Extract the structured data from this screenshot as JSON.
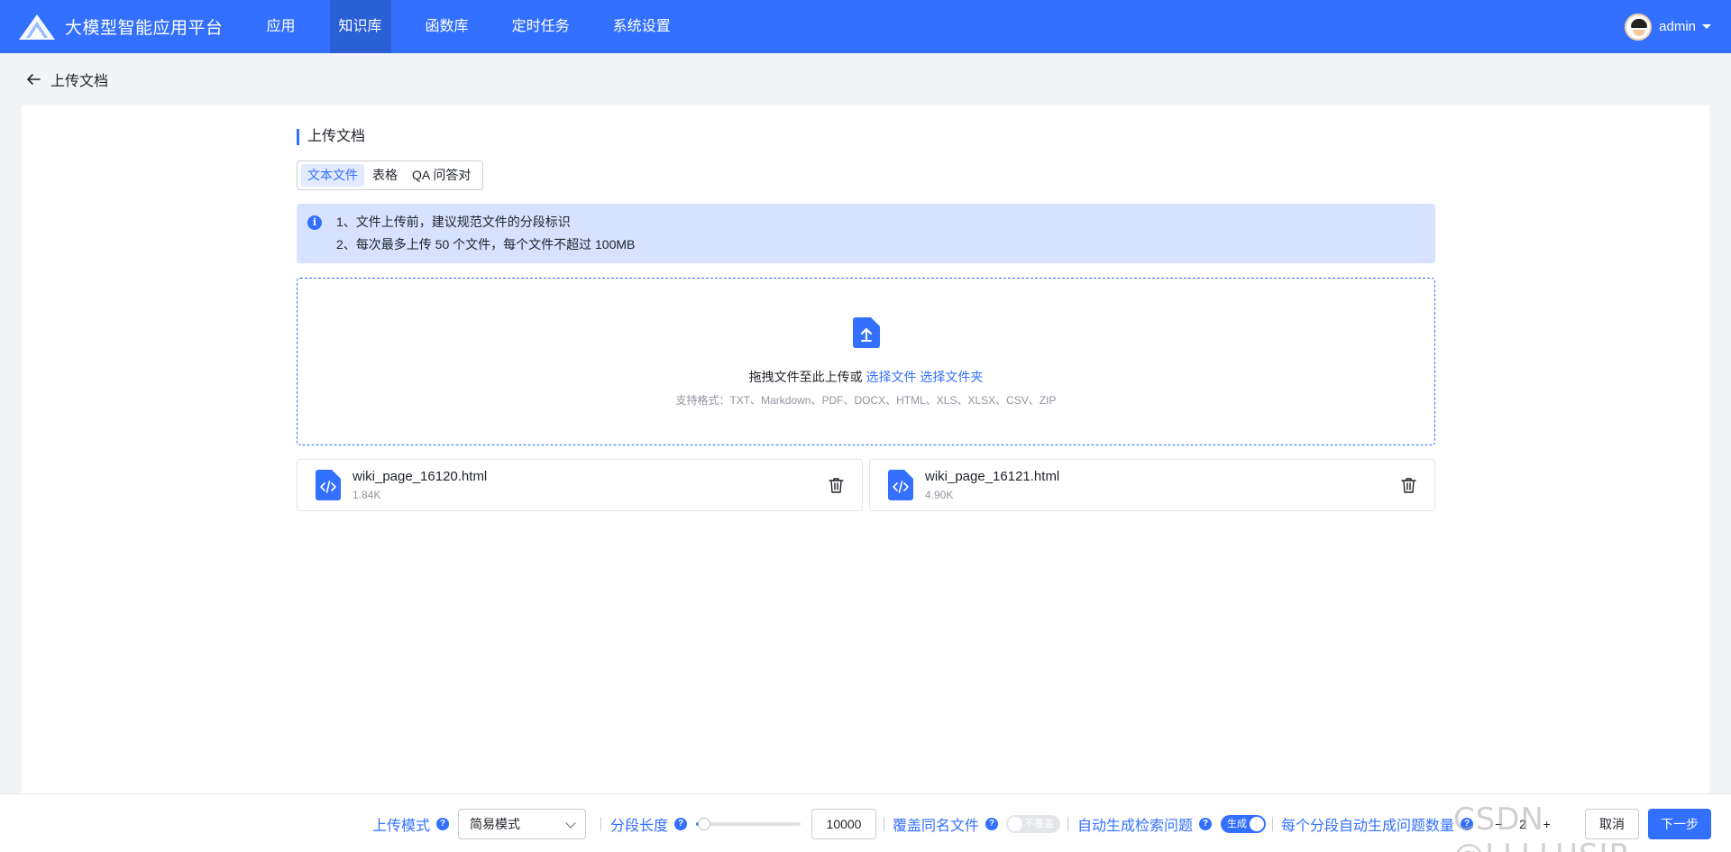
{
  "header": {
    "brand": "大模型智能应用平台",
    "nav": [
      {
        "label": "应用",
        "active": false
      },
      {
        "label": "知识库",
        "active": true
      },
      {
        "label": "函数库",
        "active": false
      },
      {
        "label": "定时任务",
        "active": false
      },
      {
        "label": "系统设置",
        "active": false
      }
    ],
    "user": "admin",
    "accent": "#3370ff"
  },
  "breadcrumb": {
    "back_label": "上传文档"
  },
  "main": {
    "section_title": "上传文档",
    "tabs": [
      {
        "label": "文本文件",
        "active": true
      },
      {
        "label": "表格",
        "active": false
      },
      {
        "label": "QA 问答对",
        "active": false
      }
    ],
    "notice": {
      "line1": "1、文件上传前，建议规范文件的分段标识",
      "line2": "2、每次最多上传 50 个文件，每个文件不超过 100MB"
    },
    "dropzone": {
      "text": "拖拽文件至此上传或",
      "select_file": "选择文件",
      "select_folder": "选择文件夹",
      "hint": "支持格式：TXT、Markdown、PDF、DOCX、HTML、XLS、XLSX、CSV、ZIP"
    },
    "files": [
      {
        "name": "wiki_page_16120.html",
        "size": "1.84K",
        "icon": "html-file-icon"
      },
      {
        "name": "wiki_page_16121.html",
        "size": "4.90K",
        "icon": "html-file-icon"
      }
    ]
  },
  "bottom": {
    "upload_mode_label": "上传模式",
    "upload_mode_value": "简易模式",
    "segment_length_label": "分段长度",
    "segment_length_value": "10000",
    "segment_slider_fraction": 0.08,
    "overwrite_label": "覆盖同名文件",
    "overwrite_switch_text": "不覆盖",
    "overwrite_on": false,
    "auto_question_label": "自动生成检索问题",
    "auto_question_switch_text": "生成",
    "auto_question_on": true,
    "per_segment_label": "每个分段自动生成问题数量",
    "stepper_minus": "−",
    "stepper_value": "2",
    "stepper_plus": "+",
    "cancel": "取消",
    "next": "下一步"
  },
  "watermark": "CSDN @LLLLUSIR"
}
